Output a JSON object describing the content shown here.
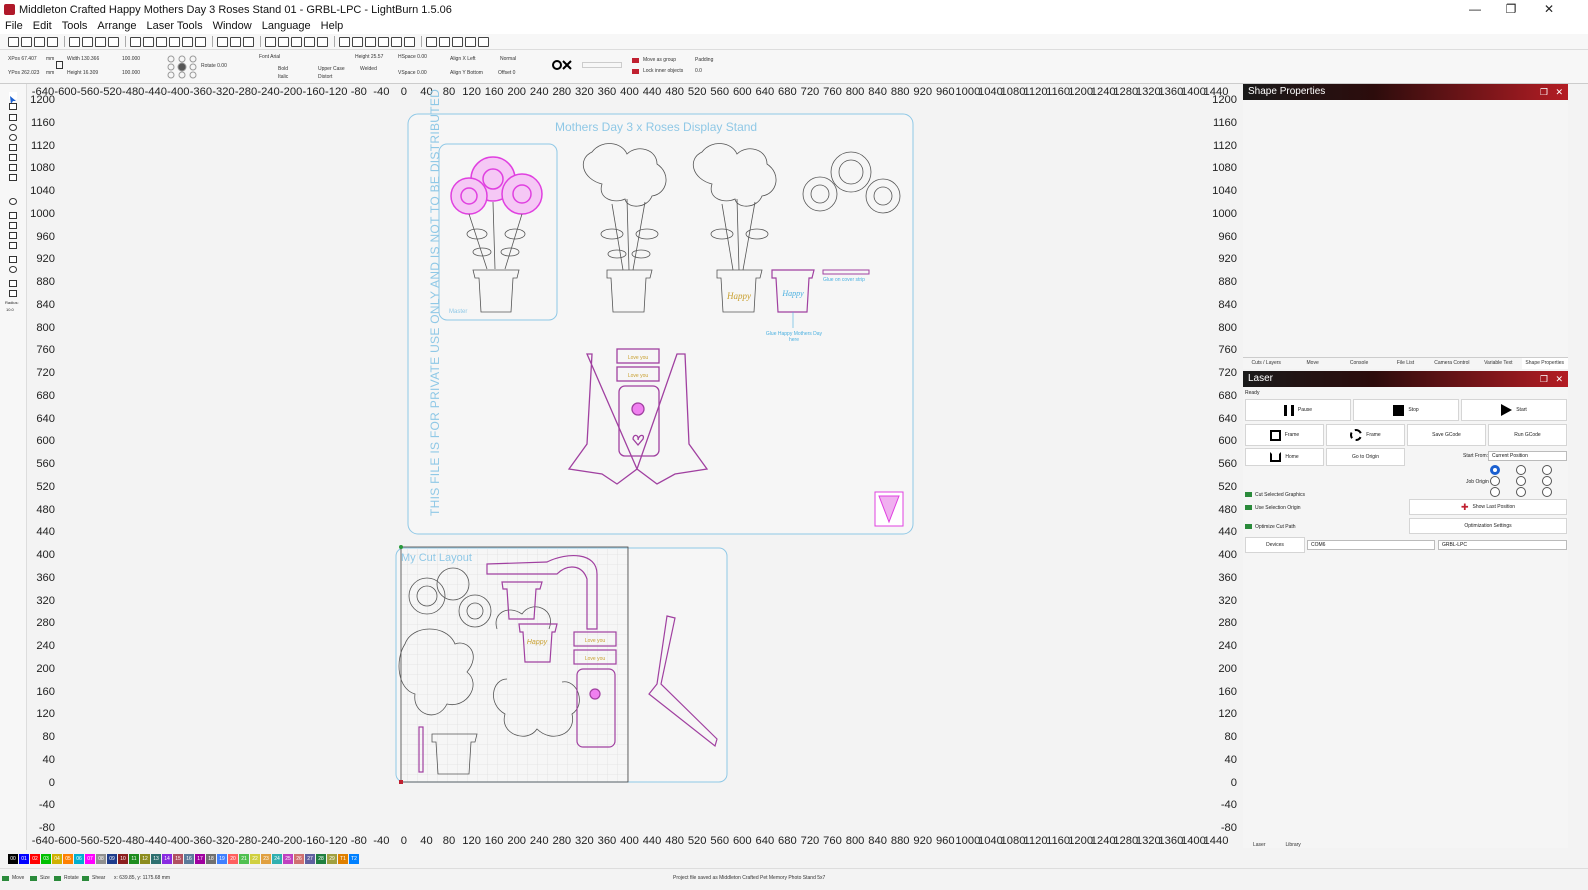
{
  "window": {
    "title": "Middleton Crafted Happy Mothers Day 3 Roses Stand 01 - GRBL-LPC - LightBurn 1.5.06",
    "minimize": "—",
    "maximize": "❐",
    "close": "✕"
  },
  "menu": [
    "File",
    "Edit",
    "Tools",
    "Arrange",
    "Laser Tools",
    "Window",
    "Language",
    "Help"
  ],
  "numeric_toolbar": {
    "xpos": "XPos 67.407",
    "ypos": "YPos 262.023",
    "width": "Width 130.366",
    "height": "Height 16.309",
    "unit1": "mm",
    "unit2": "mm",
    "pct1": "100.000",
    "pct2": "100.000",
    "rotate": "Rotate 0.00",
    "font": "Font Arial",
    "font_height": "Height 25.57",
    "hspace": "HSpace 0.00",
    "vspace": "VSpace 0.00",
    "bold": "Bold",
    "italic": "Italic",
    "upper": "Upper Case",
    "distort": "Distort",
    "welded": "Welded",
    "align_x": "Align X Left",
    "align_y": "Align Y Bottom",
    "normal": "Normal",
    "offset": "Offset 0",
    "move_group": "Move as group",
    "lock_inner": "Lock inner objects",
    "padding": "Padding",
    "padding_val": "0.0"
  },
  "left_tools": {
    "radius": "Radius:",
    "radius_val": "10.0"
  },
  "ruler": {
    "x": [
      "-640",
      "-600",
      "-560",
      "-520",
      "-480",
      "-440",
      "-400",
      "-360",
      "-320",
      "-280",
      "-240",
      "-200",
      "-160",
      "-120",
      "-80",
      "-40",
      "0",
      "40",
      "80",
      "120",
      "160",
      "200",
      "240",
      "280",
      "320",
      "360",
      "400",
      "440",
      "480",
      "520",
      "560",
      "600",
      "640",
      "680",
      "720",
      "760",
      "800",
      "840",
      "880",
      "920",
      "960",
      "1000",
      "1040",
      "1080",
      "1120",
      "1160",
      "1200",
      "1240",
      "1280",
      "1320",
      "1360",
      "1400",
      "1440"
    ],
    "y": [
      "1200",
      "1160",
      "1120",
      "1080",
      "1040",
      "1000",
      "960",
      "920",
      "880",
      "840",
      "800",
      "760",
      "720",
      "680",
      "640",
      "600",
      "560",
      "520",
      "480",
      "440",
      "400",
      "360",
      "320",
      "280",
      "240",
      "200",
      "160",
      "120",
      "80",
      "40",
      "0",
      "-40",
      "-80"
    ]
  },
  "canvas": {
    "stand_title": "Mothers Day 3 x Roses Display Stand",
    "watermark": "THIS FILE IS FOR PRIVATE USE ONLY AND IS NOT TO BE DISTRIBUTED",
    "master_label": "Master",
    "glue_cover": "Glue on cover strip",
    "glue_happy": "Glue Happy Mothers Day here",
    "love_you": "Love you",
    "happy_mothers_day": "Happy Mothers Day",
    "layout_label": "My Cut Layout"
  },
  "shape_panel": {
    "title": "Shape Properties"
  },
  "dock_tabs": [
    "Cuts / Layers",
    "Move",
    "Console",
    "File List",
    "Camera Control",
    "Variable Text",
    "Shape Properties"
  ],
  "laser_panel": {
    "title": "Laser",
    "status": "Ready",
    "pause": "Pause",
    "stop": "Stop",
    "start": "Start",
    "frame1": "Frame",
    "frame2": "Frame",
    "save_gcode": "Save GCode",
    "run_gcode": "Run GCode",
    "home": "Home",
    "go_origin": "Go to Origin",
    "start_from": "Start From:",
    "start_from_val": "Current Position",
    "job_origin": "Job Origin",
    "cut_selected": "Cut Selected Graphics",
    "use_selection": "Use Selection Origin",
    "optimize": "Optimize Cut Path",
    "show_last": "Show Last Position",
    "opt_settings": "Optimization Settings",
    "devices": "Devices",
    "port": "COM6",
    "device": "GRBL-LPC"
  },
  "bottom_tabs": [
    "Laser",
    "Library"
  ],
  "palette": {
    "labels": [
      "00",
      "01",
      "02",
      "03",
      "04",
      "05",
      "06",
      "07",
      "08",
      "09",
      "10",
      "11",
      "12",
      "13",
      "14",
      "15",
      "16",
      "17",
      "18",
      "19",
      "20",
      "21",
      "22",
      "23",
      "24",
      "25",
      "26",
      "27",
      "28",
      "29",
      "T1",
      "T2"
    ],
    "colors": [
      "#000000",
      "#0000ff",
      "#ff0000",
      "#00c000",
      "#d0b000",
      "#ff8000",
      "#00b0d0",
      "#ff00ff",
      "#909090",
      "#1e3c8c",
      "#8c1e1e",
      "#1e8c1e",
      "#8c8c1e",
      "#2e7070",
      "#8a2be2",
      "#b05060",
      "#5a7a9a",
      "#a000a0",
      "#707070",
      "#4080ff",
      "#ff6060",
      "#50c050",
      "#d0d040",
      "#e0a040",
      "#30b0b0",
      "#c040c0",
      "#d07070",
      "#6060a0",
      "#208040",
      "#a0a040",
      "#e08000",
      "#0080ff"
    ]
  },
  "status": {
    "move": "Move",
    "size": "Size",
    "rotate": "Rotate",
    "shear": "Shear",
    "coords": "x: 639.85, y: 1175.68 mm",
    "message": "Project file saved as Middleton Crafted Pet Memory Photo Stand 5x7"
  }
}
